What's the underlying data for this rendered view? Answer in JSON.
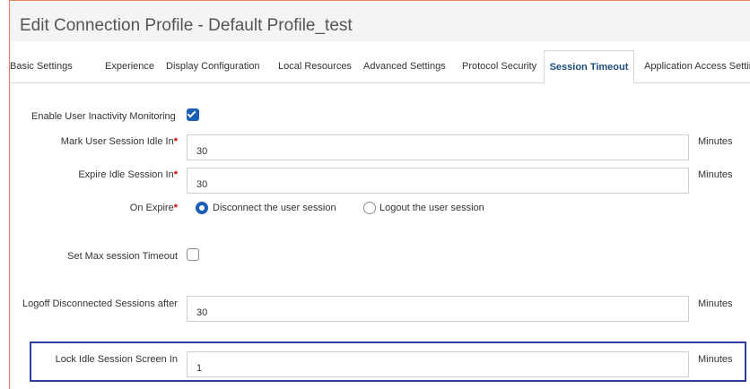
{
  "window": {
    "title": "Edit Connection Profile - Default Profile_test"
  },
  "tabs": [
    {
      "label": "Basic Settings"
    },
    {
      "label": "Experience"
    },
    {
      "label": "Display Configuration"
    },
    {
      "label": "Local Resources"
    },
    {
      "label": "Advanced Settings"
    },
    {
      "label": "Protocol Security"
    },
    {
      "label": "Session Timeout",
      "active": true
    },
    {
      "label": "Application Access Settin"
    }
  ],
  "form": {
    "inactivity": {
      "label": "Enable User Inactivity Monitoring",
      "checked": true
    },
    "idle_in": {
      "label": "Mark User Session Idle In",
      "required_mark": "*",
      "value": "30",
      "unit": "Minutes"
    },
    "expire_in": {
      "label": "Expire Idle Session In",
      "required_mark": "*",
      "value": "30",
      "unit": "Minutes"
    },
    "on_expire": {
      "label": "On Expire",
      "required_mark": "*",
      "options": [
        {
          "label": "Disconnect the user session",
          "selected": true
        },
        {
          "label": "Logout the user session",
          "selected": false
        }
      ]
    },
    "max_timeout": {
      "label": "Set Max session Timeout",
      "checked": false
    },
    "logoff": {
      "label": "Logoff Disconnected Sessions after",
      "value": "30",
      "unit": "Minutes"
    },
    "lock": {
      "label": "Lock Idle Session Screen In",
      "value": "1",
      "unit": "Minutes"
    }
  },
  "colors": {
    "accent": "#1a5fb4",
    "highlight_border": "#2f3f9f",
    "frame_border": "#e2845c",
    "required": "#cc0000"
  }
}
